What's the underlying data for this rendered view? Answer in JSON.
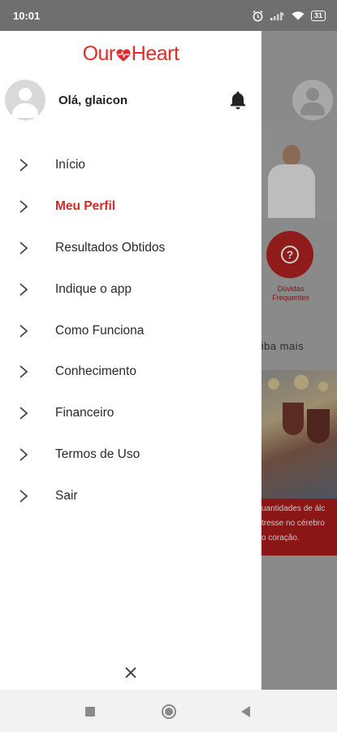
{
  "status_bar": {
    "time": "10:01",
    "battery": "31"
  },
  "drawer": {
    "logo": {
      "part1": "Our",
      "part2": "Heart",
      "color": "#e02b2b"
    },
    "user": {
      "greeting": "Olá, glaicon"
    },
    "menu": [
      {
        "label": "Início",
        "active": false
      },
      {
        "label": "Meu Perfil",
        "active": true
      },
      {
        "label": "Resultados Obtidos",
        "active": false
      },
      {
        "label": "Indique o app",
        "active": false
      },
      {
        "label": "Como Funciona",
        "active": false
      },
      {
        "label": "Conhecimento",
        "active": false
      },
      {
        "label": "Financeiro",
        "active": false
      },
      {
        "label": "Termos de Uso",
        "active": false
      },
      {
        "label": "Sair",
        "active": false
      }
    ],
    "active_color": "#d42a2a"
  },
  "background": {
    "faq_label_line1": "Dúvidas",
    "faq_label_line2": "Frequentes",
    "saiba_mais": "aiba mais",
    "news_lines": [
      "uantidades de álc",
      "tresse no cérebro",
      "o coração."
    ]
  }
}
